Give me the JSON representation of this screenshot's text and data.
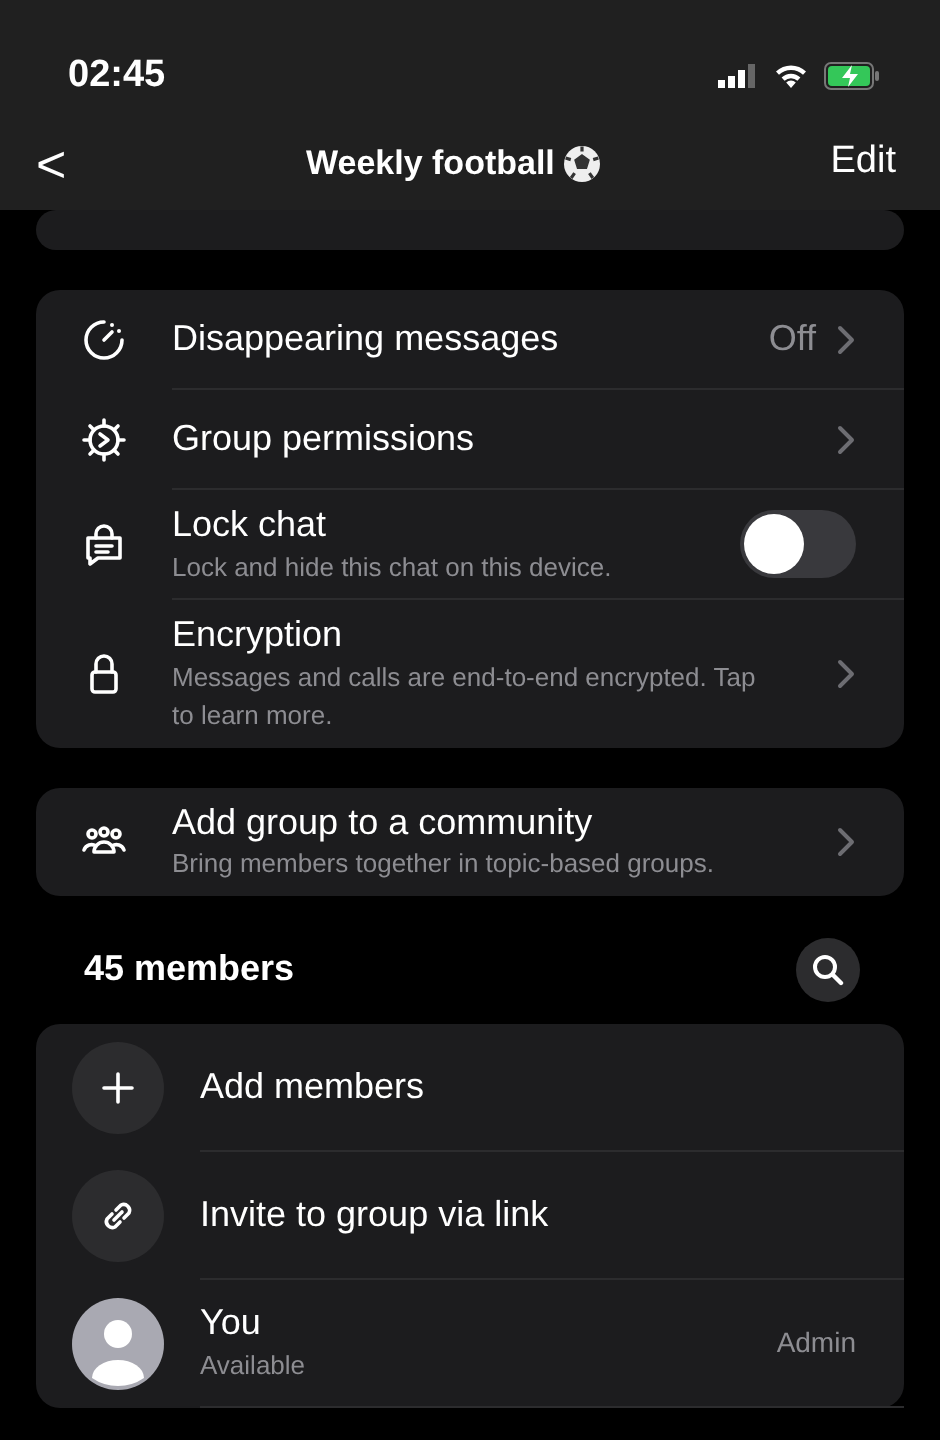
{
  "status_bar": {
    "time": "02:45"
  },
  "nav": {
    "back": "<",
    "title": "Weekly football",
    "action": "Edit"
  },
  "sections": [
    {
      "rows": [
        {
          "kind": "link",
          "label": "Disappearing messages",
          "value": "Off"
        },
        {
          "kind": "link",
          "label": "Group permissions"
        },
        {
          "kind": "toggle",
          "label": "Lock chat",
          "subtitle": "Lock and hide this chat on this device.",
          "on": false
        },
        {
          "kind": "link",
          "label": "Encryption",
          "subtitle": "Messages and calls are end-to-end encrypted. Tap to learn more."
        }
      ]
    },
    {
      "rows": [
        {
          "kind": "link",
          "label": "Add group to a community",
          "subtitle": "Bring members together in topic-based groups."
        }
      ]
    }
  ],
  "members": {
    "heading": "45 members",
    "rows": [
      {
        "kind": "action",
        "label": "Add members"
      },
      {
        "kind": "action",
        "label": "Invite to group via link"
      },
      {
        "kind": "member",
        "label": "You",
        "subtitle": "Available",
        "role": "Admin"
      }
    ]
  }
}
